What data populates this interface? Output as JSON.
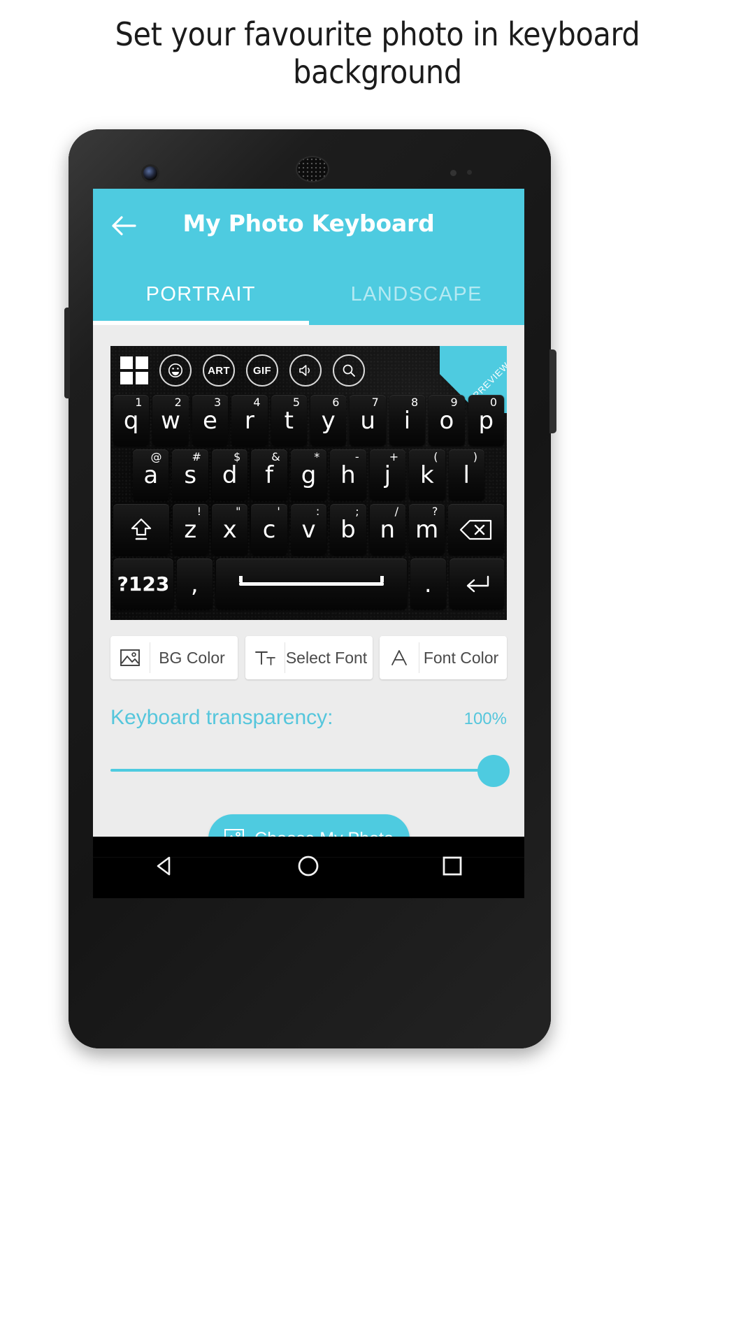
{
  "promo": {
    "headline": "Set your favourite photo in keyboard background"
  },
  "theme": {
    "accent": "#4ecbe0",
    "accent_text": "#55c6dc",
    "screen_bg": "#ececec",
    "keyboard_bg": "#0a0a0a",
    "appbar_text": "#ffffff"
  },
  "appbar": {
    "title": "My Photo Keyboard",
    "back_icon": "arrow-left-icon"
  },
  "tabs": [
    {
      "label": "PORTRAIT",
      "active": true
    },
    {
      "label": "LANDSCAPE",
      "active": false
    }
  ],
  "keyboard_preview": {
    "badge": "PREVIEW",
    "toolbar": [
      {
        "name": "grid-icon",
        "label": ""
      },
      {
        "name": "emoji-icon",
        "label": ""
      },
      {
        "name": "art-icon",
        "label": "ART"
      },
      {
        "name": "gif-icon",
        "label": "GIF"
      },
      {
        "name": "sound-icon",
        "label": ""
      },
      {
        "name": "search-icon",
        "label": ""
      }
    ],
    "rows": [
      [
        {
          "key": "q",
          "sup": "1"
        },
        {
          "key": "w",
          "sup": "2"
        },
        {
          "key": "e",
          "sup": "3"
        },
        {
          "key": "r",
          "sup": "4"
        },
        {
          "key": "t",
          "sup": "5"
        },
        {
          "key": "y",
          "sup": "6"
        },
        {
          "key": "u",
          "sup": "7"
        },
        {
          "key": "i",
          "sup": "8"
        },
        {
          "key": "o",
          "sup": "9"
        },
        {
          "key": "p",
          "sup": "0"
        }
      ],
      [
        {
          "key": "a",
          "sup": "@"
        },
        {
          "key": "s",
          "sup": "#"
        },
        {
          "key": "d",
          "sup": "$"
        },
        {
          "key": "f",
          "sup": "&"
        },
        {
          "key": "g",
          "sup": "*"
        },
        {
          "key": "h",
          "sup": "-"
        },
        {
          "key": "j",
          "sup": "+"
        },
        {
          "key": "k",
          "sup": "("
        },
        {
          "key": "l",
          "sup": ")"
        }
      ],
      [
        {
          "key": "",
          "sup": "",
          "icon": "shift-icon"
        },
        {
          "key": "z",
          "sup": "!"
        },
        {
          "key": "x",
          "sup": "\""
        },
        {
          "key": "c",
          "sup": "'"
        },
        {
          "key": "v",
          "sup": ":"
        },
        {
          "key": "b",
          "sup": ";"
        },
        {
          "key": "n",
          "sup": "/"
        },
        {
          "key": "m",
          "sup": "?"
        },
        {
          "key": "",
          "sup": "",
          "icon": "backspace-icon"
        }
      ],
      [
        {
          "key": "?123",
          "sup": ""
        },
        {
          "key": ",",
          "sup": ""
        },
        {
          "key": "",
          "sup": "",
          "icon": "space-icon"
        },
        {
          "key": ".",
          "sup": ""
        },
        {
          "key": "",
          "sup": "",
          "icon": "enter-icon"
        }
      ]
    ]
  },
  "options": [
    {
      "label": "BG Color",
      "icon": "image-icon"
    },
    {
      "label": "Select Font",
      "icon": "text-format-icon"
    },
    {
      "label": "Font Color",
      "icon": "font-color-icon"
    }
  ],
  "transparency": {
    "label": "Keyboard transparency:",
    "value_label": "100%",
    "value": 100,
    "min": 0,
    "max": 100
  },
  "cta": {
    "label": "Choose My Photo",
    "icon": "image-icon"
  },
  "navbar": [
    {
      "name": "back-nav-icon"
    },
    {
      "name": "home-nav-icon"
    },
    {
      "name": "recents-nav-icon"
    }
  ]
}
